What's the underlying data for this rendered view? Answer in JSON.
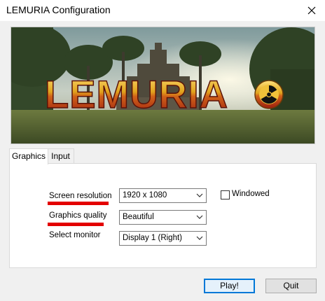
{
  "window": {
    "title": "LEMURIA Configuration"
  },
  "banner": {
    "logo_text": "LEMURIA"
  },
  "tabs": [
    {
      "label": "Graphics",
      "active": true
    },
    {
      "label": "Input",
      "active": false
    }
  ],
  "graphics": {
    "resolution": {
      "label": "Screen resolution",
      "value": "1920 x 1080"
    },
    "quality": {
      "label": "Graphics quality",
      "value": "Beautiful"
    },
    "monitor": {
      "label": "Select monitor",
      "value": "Display 1 (Right)"
    },
    "windowed": {
      "label": "Windowed",
      "checked": false
    }
  },
  "buttons": {
    "play": "Play!",
    "quit": "Quit"
  },
  "colors": {
    "highlight": "#e30000",
    "accent": "#0078d7"
  }
}
